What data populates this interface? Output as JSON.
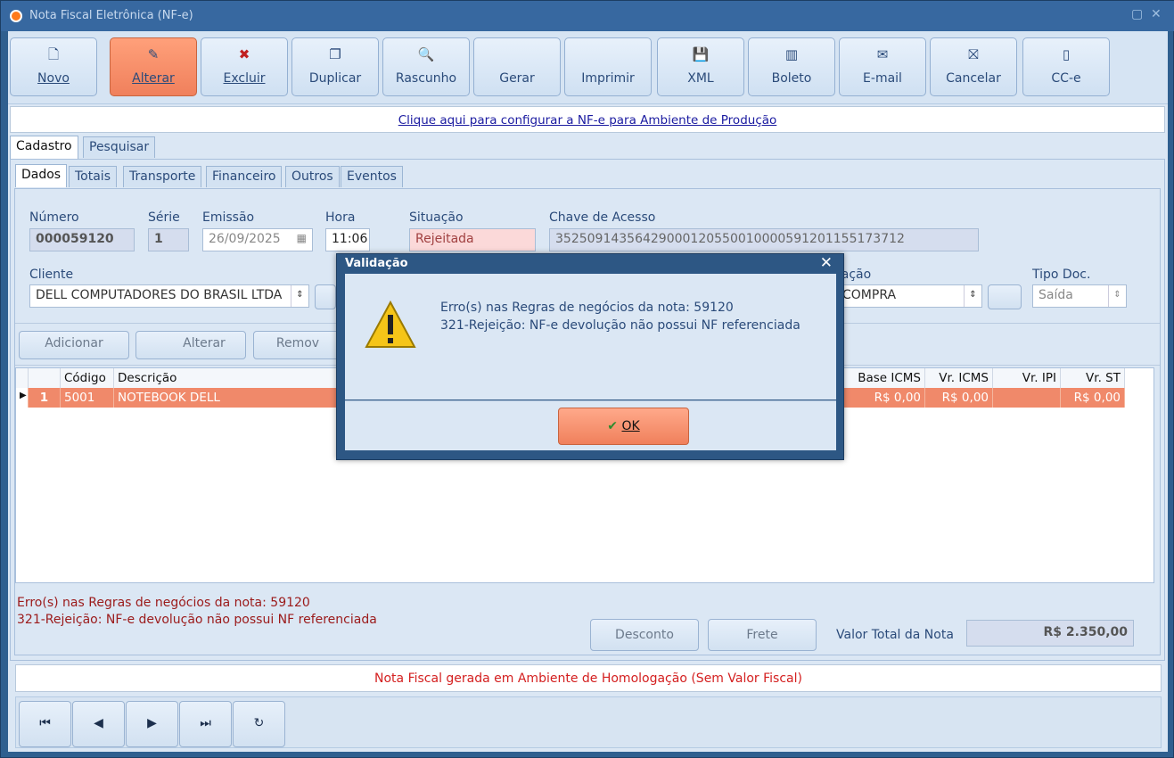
{
  "window": {
    "title": "Nota Fiscal Eletrônica (NF-e)"
  },
  "toolbar": {
    "buttons": [
      {
        "label": "Novo",
        "icon": "new-document-icon",
        "glyph": "🗋"
      },
      {
        "label": "Alterar",
        "icon": "edit-icon",
        "glyph": "✎"
      },
      {
        "label": "Excluir",
        "icon": "delete-icon",
        "glyph": "✖"
      },
      {
        "label": "Duplicar",
        "icon": "duplicate-icon",
        "glyph": "❐"
      },
      {
        "label": "Rascunho",
        "icon": "draft-icon",
        "glyph": "🔍"
      },
      {
        "label": "Gerar",
        "icon": "generate-icon",
        "glyph": ""
      },
      {
        "label": "Imprimir",
        "icon": "print-icon",
        "glyph": ""
      },
      {
        "label": "XML",
        "icon": "save-icon",
        "glyph": "💾"
      },
      {
        "label": "Boleto",
        "icon": "barcode-icon",
        "glyph": "▥"
      },
      {
        "label": "E-mail",
        "icon": "mail-icon",
        "glyph": "✉"
      },
      {
        "label": "Cancelar",
        "icon": "cancel-icon",
        "glyph": "⛝"
      },
      {
        "label": "CC-e",
        "icon": "letter-icon",
        "glyph": "▯"
      }
    ]
  },
  "link": {
    "text": "Clique aqui para configurar a NF-e para Ambiente de Produção"
  },
  "main_tabs": [
    "Cadastro",
    "Pesquisar"
  ],
  "sub_tabs": [
    "Dados",
    "Totais",
    "Transporte",
    "Financeiro",
    "Outros",
    "Eventos"
  ],
  "form": {
    "numero_label": "Número",
    "numero": "000059120",
    "serie_label": "Série",
    "serie": "1",
    "emissao_label": "Emissão",
    "emissao": "26/09/2025",
    "hora_label": "Hora",
    "hora": "11:06",
    "situacao_label": "Situação",
    "situacao": "Rejeitada",
    "chave_label": "Chave de Acesso",
    "chave": "35250914356429000120550010000591201155173712",
    "cliente_label": "Cliente",
    "cliente": "DELL COMPUTADORES DO BRASIL LTDA",
    "operacao_label": "ração",
    "operacao": "COMPRA",
    "tipo_label": "Tipo Doc.",
    "tipo": "Saída"
  },
  "item_buttons": {
    "add": "Adicionar",
    "edit": "Alterar",
    "remove": "Remov"
  },
  "grid": {
    "headers": [
      "Código",
      "Descrição",
      "Base ICMS",
      "Vr. ICMS",
      "Vr. IPI",
      "Vr. ST"
    ],
    "row": {
      "num": "1",
      "codigo": "5001",
      "descricao": "NOTEBOOK DELL",
      "base_icms": "R$ 0,00",
      "vr_icms": "R$ 0,00",
      "vr_ipi": "",
      "vr_st": "R$ 0,00"
    }
  },
  "errors": {
    "line1": "Erro(s) nas Regras de negócios da nota: 59120",
    "line2": "321-Rejeição: NF-e devolução não possui NF referenciada"
  },
  "footer_buttons": {
    "desconto": "Desconto",
    "frete": "Frete"
  },
  "total": {
    "label": "Valor Total da Nota",
    "value": "R$ 2.350,00"
  },
  "status": {
    "text": "Nota Fiscal gerada em Ambiente de Homologação (Sem Valor Fiscal)"
  },
  "nav": {
    "first": "⏮",
    "prev": "◀",
    "next": "▶",
    "last": "⏭",
    "refresh": "↻"
  },
  "dialog": {
    "title": "Validação",
    "line1": "Erro(s) nas Regras de negócios da nota: 59120",
    "line2": "321-Rejeição: NF-e devolução não possui NF referenciada",
    "ok": "OK",
    "close": "✕"
  },
  "colors": {
    "accent": "#f0805c",
    "title_bg": "#3768a0",
    "panel": "#dbe7f4",
    "error_text": "#9b1a1a",
    "status_text": "#d42020"
  }
}
